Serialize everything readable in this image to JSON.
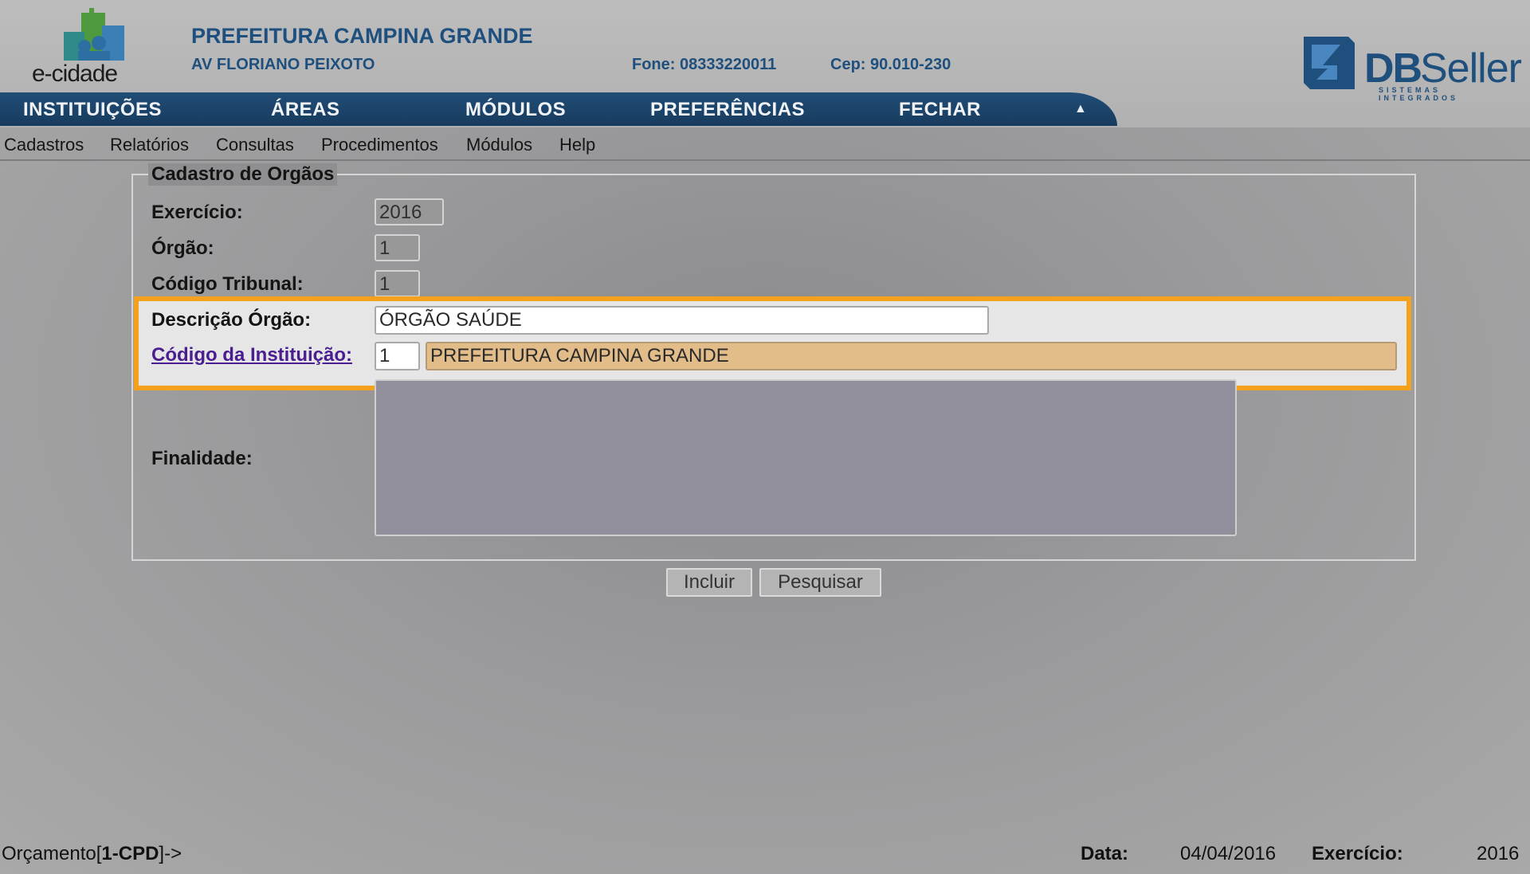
{
  "header": {
    "logo_text": "e-cidade",
    "institution_name": "PREFEITURA CAMPINA GRANDE",
    "address": "AV FLORIANO PEIXOTO",
    "phone": "Fone: 08333220011",
    "cep": "Cep: 90.010-230",
    "brand_db": "DB",
    "brand_seller": "Seller",
    "brand_tagline": "SISTEMAS INTEGRADOS"
  },
  "main_nav": {
    "items": [
      "INSTITUIÇÕES",
      "ÁREAS",
      "MÓDULOS",
      "PREFERÊNCIAS",
      "FECHAR"
    ],
    "collapse_icon": "▲"
  },
  "sub_menu": {
    "items": [
      "Cadastros",
      "Relatórios",
      "Consultas",
      "Procedimentos",
      "Módulos",
      "Help"
    ]
  },
  "form": {
    "legend": "Cadastro de Orgãos",
    "exercicio_label": "Exercício:",
    "exercicio_value": "2016",
    "orgao_label": "Órgão:",
    "orgao_value": "1",
    "codigo_tribunal_label": "Código Tribunal:",
    "codigo_tribunal_value": "1",
    "descricao_label": "Descrição Órgão:",
    "descricao_value": "ÓRGÃO SAÚDE",
    "instituicao_label": "Código da Instituição:",
    "instituicao_code": "1",
    "instituicao_name": "PREFEITURA CAMPINA GRANDE",
    "finalidade_label": "Finalidade:",
    "finalidade_value": ""
  },
  "buttons": {
    "incluir": "Incluir",
    "pesquisar": "Pesquisar"
  },
  "status_bar": {
    "module_prefix": "Orçamento[",
    "module_code": "1-CPD",
    "module_suffix": "]->",
    "data_label": "Data:",
    "data_value": "04/04/2016",
    "exercicio_label": "Exercício:",
    "exercicio_value": "2016"
  },
  "colors": {
    "nav_bar": "#1d4670",
    "highlight_border": "#f4a21e",
    "lookup_field": "#e2bd89",
    "link": "#4a1e91"
  }
}
